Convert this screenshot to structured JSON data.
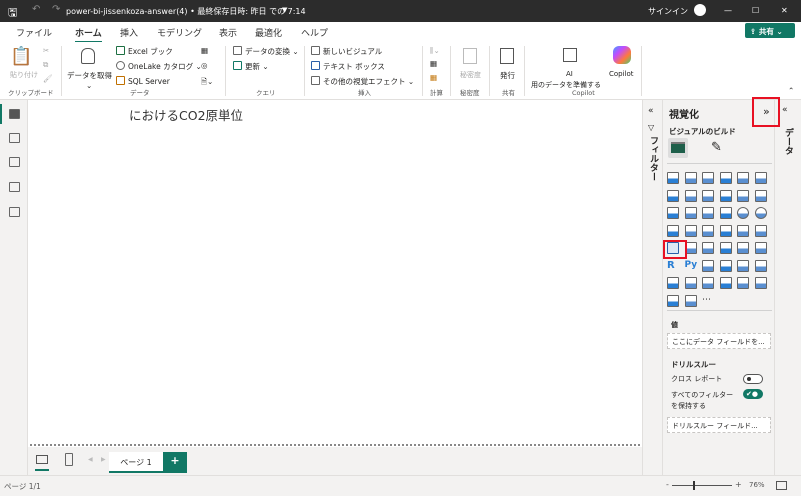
{
  "titlebar": {
    "title": "power-bi-jissenkoza-answer(4) • 最終保存日時: 昨日 での 7:14",
    "signin": "サインイン",
    "minimize": "—",
    "maximize": "☐",
    "close": "✕"
  },
  "tabs": [
    "ファイル",
    "ホーム",
    "挿入",
    "モデリング",
    "表示",
    "最適化",
    "ヘルプ"
  ],
  "active_tab": "ホーム",
  "share": "共有",
  "ribbon": {
    "clipboard": {
      "paste": "貼り付け",
      "group": "クリップボード"
    },
    "data": {
      "get_data": "データを取得",
      "excel": "Excel ブック",
      "onelake": "OneLake カタログ",
      "sql": "SQL Server",
      "group": "データ"
    },
    "query": {
      "transform": "データの変換",
      "refresh": "更新",
      "group": "クエリ"
    },
    "insert": {
      "new_visual": "新しいビジュアル",
      "textbox": "テキスト ボックス",
      "more_visuals": "その他の視覚エフェクト",
      "group": "挿入"
    },
    "calc": {
      "group": "計算"
    },
    "sensitivity": {
      "label": "秘密度",
      "group": "秘密度"
    },
    "share": {
      "publish": "発行",
      "group": "共有"
    },
    "copilot": {
      "ai_line1": "AI",
      "ai_line2": "用のデータを準備する",
      "copilot": "Copilot",
      "group": "Copilot"
    }
  },
  "canvas": {
    "title": "におけるCO2原単位"
  },
  "pages": {
    "tab": "ページ 1",
    "add": "+"
  },
  "status": {
    "page": "ページ 1/1",
    "zoom": "76%"
  },
  "filters": {
    "label": "フィルター"
  },
  "data_pane": {
    "label": "データ"
  },
  "viz": {
    "title": "視覚化",
    "build": "ビジュアルのビルド",
    "values_label": "値",
    "values_placeholder": "ここにデータ フィールドを...",
    "drill_title": "ドリルスルー",
    "cross_report": "クロス レポート",
    "cross_report_on": false,
    "keep_filters_1": "すべてのフィルター",
    "keep_filters_2": "を保持する",
    "keep_filters_on": true,
    "drill_placeholder": "ドリルスルー フィールド...",
    "more": "⋯",
    "selected_visual": "card"
  },
  "colors": {
    "accent": "#117865",
    "highlight": "#e81123",
    "titlebar": "#2c2c2c"
  }
}
